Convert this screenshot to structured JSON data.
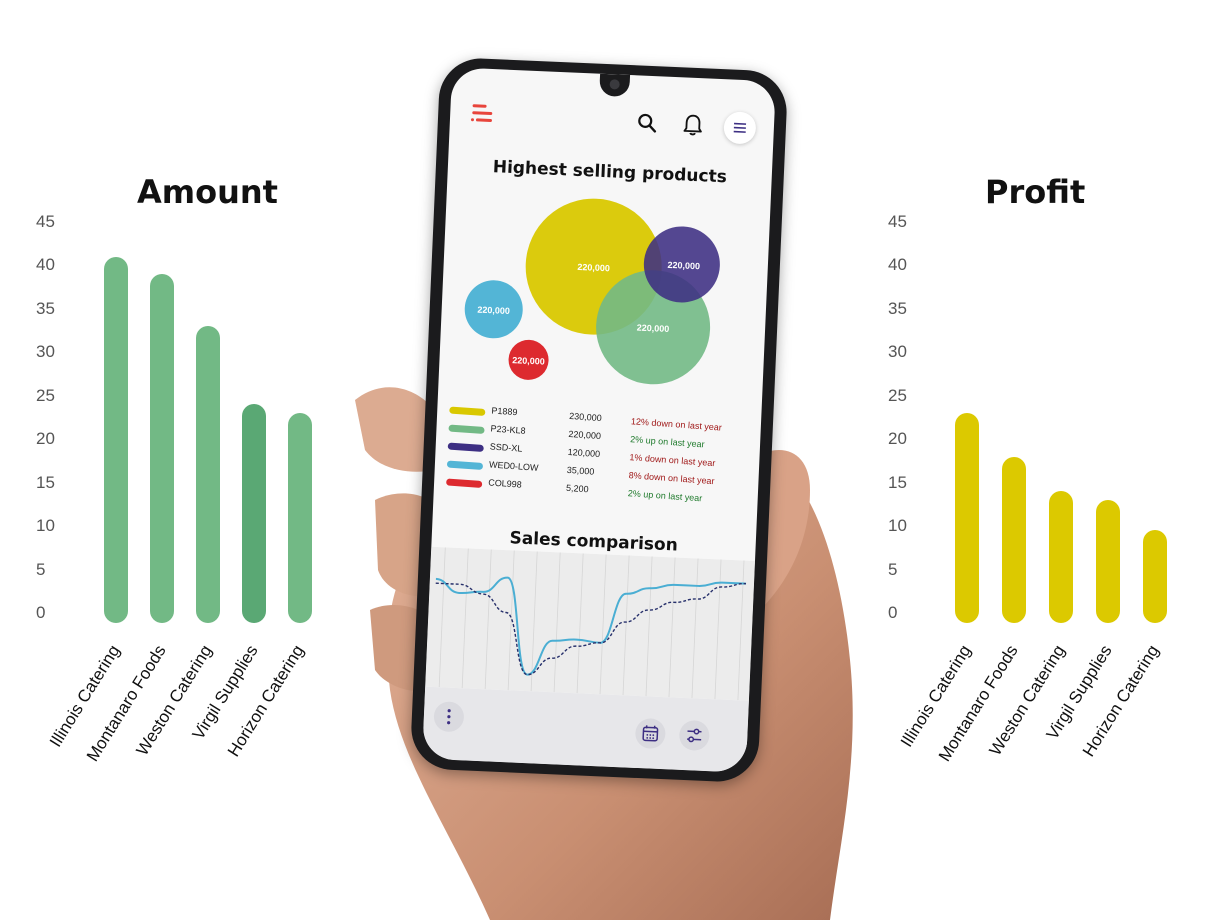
{
  "amount_chart": {
    "title": "Amount",
    "bar_color": "#72b985",
    "bar_color_highlight": "#5aa874",
    "y_ticks": [
      "45",
      "40",
      "35",
      "30",
      "25",
      "20",
      "15",
      "10",
      "5",
      "0"
    ],
    "chart_data": {
      "type": "bar",
      "title": "Amount",
      "categories": [
        "Illinois Catering",
        "Montanaro Foods",
        "Weston Catering",
        "Virgil Supplies",
        "Horizon Catering"
      ],
      "values": [
        41,
        39,
        33,
        24,
        23
      ],
      "ylim": [
        0,
        45
      ]
    }
  },
  "profit_chart": {
    "title": "Profit",
    "bar_color": "#dcc900",
    "y_ticks": [
      "45",
      "40",
      "35",
      "30",
      "25",
      "20",
      "15",
      "10",
      "5",
      "0"
    ],
    "chart_data": {
      "type": "bar",
      "title": "Profit",
      "categories": [
        "Illinois Catering",
        "Montanaro Foods",
        "Weston Catering",
        "Virgil Supplies",
        "Horizon Catering"
      ],
      "values": [
        23,
        18,
        14,
        13,
        9.5
      ],
      "ylim": [
        0,
        45
      ]
    }
  },
  "phone": {
    "app_bar": {
      "logo_icon": "app-logo-icon",
      "search_icon": "search-icon",
      "notification_icon": "bell-icon",
      "menu_icon": "hamburger-menu-icon"
    },
    "highest_selling": {
      "title": "Highest selling products",
      "chart_data": {
        "type": "scatter",
        "bubbles": [
          {
            "label": "220,000",
            "color": "#d9c800"
          },
          {
            "label": "220,000",
            "color": "#3d2f83"
          },
          {
            "label": "220,000",
            "color": "#72b985"
          },
          {
            "label": "220,000",
            "color": "#53b5d6"
          },
          {
            "label": "220,000",
            "color": "#dd2a2f"
          }
        ]
      },
      "legend": [
        {
          "name": "P1889",
          "value": "230,000",
          "change": "12% down on last year",
          "trend": "down",
          "color": "#d9c800"
        },
        {
          "name": "P23-KL8",
          "value": "220,000",
          "change": "2% up on last year",
          "trend": "up",
          "color": "#72b985"
        },
        {
          "name": "SSD-XL",
          "value": "120,000",
          "change": "1% down on last year",
          "trend": "down",
          "color": "#3d2f83"
        },
        {
          "name": "WED0-LOW",
          "value": "35,000",
          "change": "8% down on last year",
          "trend": "down",
          "color": "#53b5d6"
        },
        {
          "name": "COL998",
          "value": "5,200",
          "change": "2% up on last year",
          "trend": "up",
          "color": "#dd2a2f"
        }
      ],
      "down_color": "#a01919",
      "up_color": "#1f7a2c"
    },
    "sales_comparison": {
      "title": "Sales comparison",
      "chart_data": {
        "type": "line",
        "series": [
          {
            "color": "#4aaed3",
            "values": [
              40,
              34,
              35,
              42,
              -2,
              14,
              15,
              14,
              37,
              40,
              42,
              42,
              44,
              44
            ]
          },
          {
            "color": "#27306b",
            "values": [
              38,
              38,
              34,
              26,
              -2,
              6,
              12,
              14,
              24,
              30,
              34,
              36,
              42,
              44
            ]
          }
        ]
      }
    },
    "bottom_bar": {
      "more_icon": "more-vertical-icon",
      "calendar_icon": "calendar-icon",
      "filter_icon": "sliders-icon"
    }
  }
}
